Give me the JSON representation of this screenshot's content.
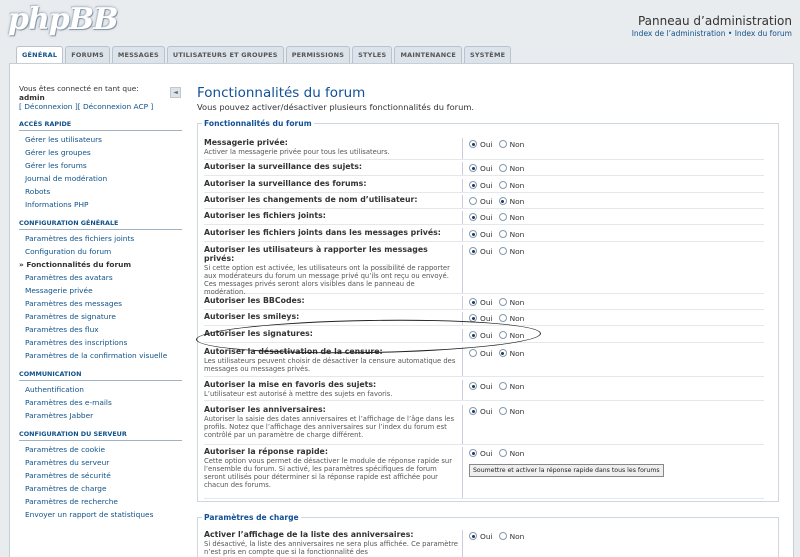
{
  "header": {
    "logo": "phpBB",
    "title": "Panneau d’administration",
    "link_acp_index": "Index de l’administration",
    "separator": "•",
    "link_forum_index": "Index du forum"
  },
  "tabs": [
    "GÉNÉRAL",
    "FORUMS",
    "MESSAGES",
    "UTILISATEURS ET GROUPES",
    "PERMISSIONS",
    "STYLES",
    "MAINTENANCE",
    "SYSTÈME"
  ],
  "sidebar": {
    "logged_in_as": "Vous êtes connecté en tant que:",
    "username": "admin",
    "links": "[ Déconnexion ][ Déconnexion ACP ]",
    "collapse_icon": "◄",
    "sections": [
      {
        "title": "ACCÈS RAPIDE",
        "items": [
          "Gérer les utilisateurs",
          "Gérer les groupes",
          "Gérer les forums",
          "Journal de modération",
          "Robots",
          "Informations PHP"
        ]
      },
      {
        "title": "CONFIGURATION GÉNÉRALE",
        "items": [
          "Paramètres des fichiers joints",
          "Configuration du forum",
          "» Fonctionnalités du forum",
          "Paramètres des avatars",
          "Messagerie privée",
          "Paramètres des messages",
          "Paramètres de signature",
          "Paramètres des flux",
          "Paramètres des inscriptions",
          "Paramètres de la confirmation visuelle"
        ]
      },
      {
        "title": "COMMUNICATION",
        "items": [
          "Authentification",
          "Paramètres des e-mails",
          "Paramètres Jabber"
        ]
      },
      {
        "title": "CONFIGURATION DU SERVEUR",
        "items": [
          "Paramètres de cookie",
          "Paramètres du serveur",
          "Paramètres de sécurité",
          "Paramètres de charge",
          "Paramètres de recherche",
          "Envoyer un rapport de statistiques"
        ]
      }
    ]
  },
  "main": {
    "title": "Fonctionnalités du forum",
    "description": "Vous pouvez activer/désactiver plusieurs fonctionnalités du forum.",
    "fieldset1": {
      "legend": "Fonctionnalités du forum",
      "yes": "Oui",
      "no": "Non",
      "rows": [
        {
          "label": "Messagerie privée:",
          "hint": "Activer la messagerie privée pour tous les utilisateurs.",
          "value": "yes"
        },
        {
          "label": "Autoriser la surveillance des sujets:",
          "hint": "",
          "value": "yes"
        },
        {
          "label": "Autoriser la surveillance des forums:",
          "hint": "",
          "value": "yes"
        },
        {
          "label": "Autoriser les changements de nom d’utilisateur:",
          "hint": "",
          "value": "no"
        },
        {
          "label": "Autoriser les fichiers joints:",
          "hint": "",
          "value": "yes"
        },
        {
          "label": "Autoriser les fichiers joints dans les messages privés:",
          "hint": "",
          "value": "yes"
        },
        {
          "label": "Autoriser les utilisateurs à rapporter les messages privés:",
          "hint": "Si cette option est activée, les utilisateurs ont la possibilité de rapporter aux modérateurs du forum un message privé qu’ils ont reçu ou envoyé. Ces messages privés seront alors visibles dans le panneau de modération.",
          "value": "yes"
        },
        {
          "label": "Autoriser les BBCodes:",
          "hint": "",
          "value": "yes"
        },
        {
          "label": "Autoriser les smileys:",
          "hint": "",
          "value": "yes"
        },
        {
          "label": "Autoriser les signatures:",
          "hint": "",
          "value": "yes"
        },
        {
          "label": "Autoriser la désactivation de la censure:",
          "hint": "Les utilisateurs peuvent choisir de désactiver la censure automatique des messages ou messages privés.",
          "value": "no"
        },
        {
          "label": "Autoriser la mise en favoris des sujets:",
          "hint": "L’utilisateur est autorisé à mettre des sujets en favoris.",
          "value": "yes"
        },
        {
          "label": "Autoriser les anniversaires:",
          "hint": "Autoriser la saisie des dates anniversaires et l’affichage de l’âge dans les profils. Notez que l’affichage des anniversaires sur l’index du forum est contrôlé par un paramètre de charge différent.",
          "value": "yes"
        },
        {
          "label": "Autoriser la réponse rapide:",
          "hint": "Cette option vous permet de désactiver le module de réponse rapide sur l’ensemble du forum. Si activé, les paramètres spécifiques de forum seront utilisés pour déterminer si la réponse rapide est affichée pour chacun des forums.",
          "value": "yes"
        }
      ],
      "quick_reply_button": "Soumettre et activer la réponse rapide dans tous les forums"
    },
    "fieldset2": {
      "legend": "Paramètres de charge",
      "rows": [
        {
          "label": "Activer l’affichage de la liste des anniversaires:",
          "hint": "Si désactivé, la liste des anniversaires ne sera plus affichée. Ce paramètre n’est pris en compte que si la fonctionnalité des",
          "value": "yes"
        }
      ]
    }
  }
}
